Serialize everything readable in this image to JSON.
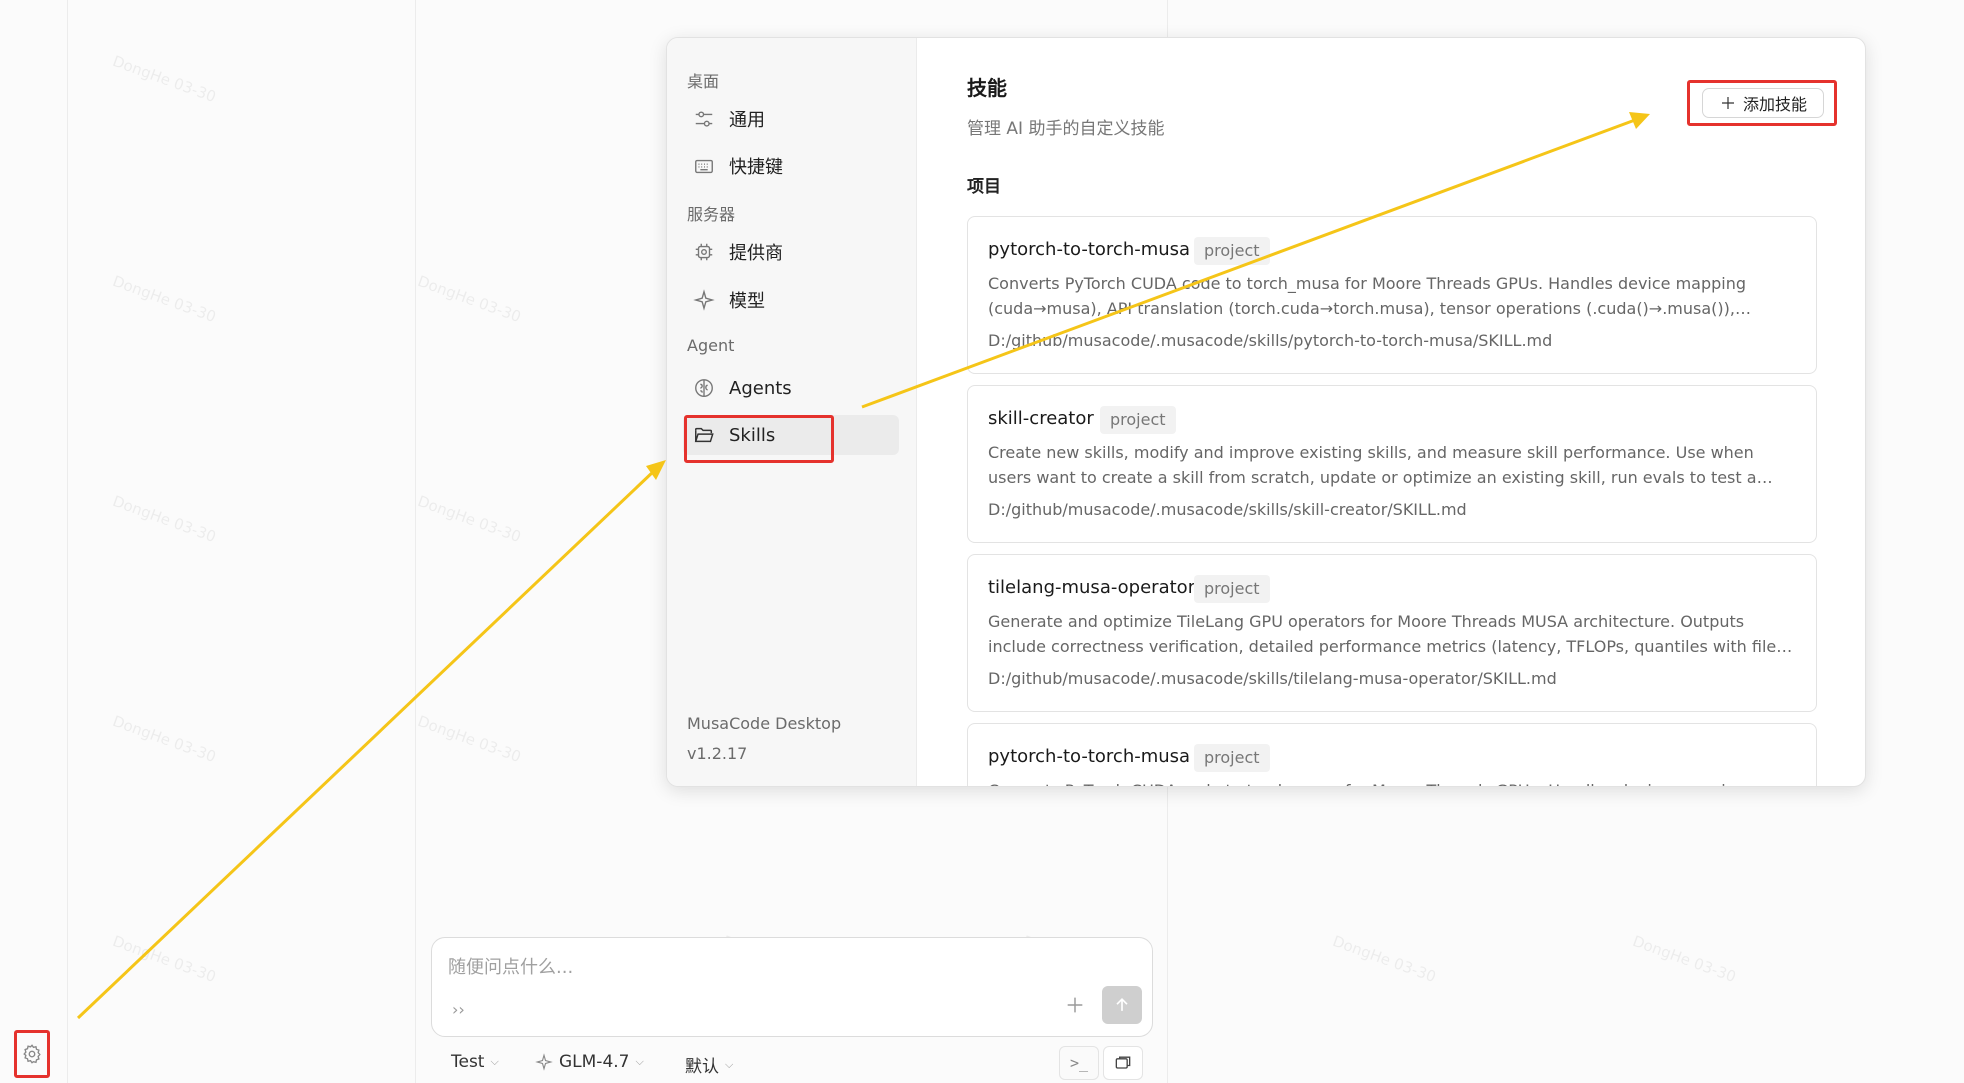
{
  "rail": {
    "settings_icon": "gear-icon"
  },
  "composer": {
    "placeholder": "随便问点什么...",
    "prefix_glyph": "››",
    "add_icon": "plus-icon",
    "send_icon": "arrow-up-icon"
  },
  "toolbar": {
    "agent": "Test",
    "model": "GLM-4.7",
    "mode": "默认",
    "terminal_icon": "terminal-icon",
    "panel_icon": "copy-window-icon"
  },
  "modal": {
    "sidebar": {
      "sections": [
        {
          "label": "桌面",
          "items": [
            {
              "label": "通用",
              "icon": "sliders-icon"
            },
            {
              "label": "快捷键",
              "icon": "keyboard-icon"
            }
          ]
        },
        {
          "label": "服务器",
          "items": [
            {
              "label": "提供商",
              "icon": "cpu-icon"
            },
            {
              "label": "模型",
              "icon": "sparkle-icon"
            }
          ]
        },
        {
          "label": "Agent",
          "items": [
            {
              "label": "Agents",
              "icon": "brain-icon"
            },
            {
              "label": "Skills",
              "icon": "folder-open-icon",
              "active": true
            }
          ]
        }
      ],
      "app_name": "MusaCode Desktop",
      "version": "v1.2.17"
    },
    "main": {
      "title": "技能",
      "subtitle": "管理 AI 助手的自定义技能",
      "add_button": "添加技能",
      "section": "项目",
      "skills": [
        {
          "name": "pytorch-to-torch-musa",
          "tag": "project",
          "description": "Converts PyTorch CUDA code to torch_musa for Moore Threads GPUs. Handles device mapping (cuda→musa), API translation (torch.cuda→torch.musa), tensor operations (.cuda()→.musa()), import...",
          "path": "D:/github/musacode/.musacode/skills/pytorch-to-torch-musa/SKILL.md"
        },
        {
          "name": "skill-creator",
          "tag": "project",
          "description": "Create new skills, modify and improve existing skills, and measure skill performance. Use when users want to create a skill from scratch, update or optimize an existing skill, run evals to test a skill,...",
          "path": "D:/github/musacode/.musacode/skills/skill-creator/SKILL.md"
        },
        {
          "name": "tilelang-musa-operator",
          "tag": "project",
          "description": "Generate and optimize TileLang GPU operators for Moore Threads MUSA architecture. Outputs include correctness verification, detailed performance metrics (latency, TFLOPs, quantiles with file export),...",
          "path": "D:/github/musacode/.musacode/skills/tilelang-musa-operator/SKILL.md"
        },
        {
          "name": "pytorch-to-torch-musa",
          "tag": "project",
          "description": "Converts PyTorch CUDA code to torch_musa for Moore Threads GPUs. Handles device mapping",
          "path": ""
        }
      ]
    }
  },
  "annotation_color": "#f5c518",
  "highlight_color": "#e5322d"
}
